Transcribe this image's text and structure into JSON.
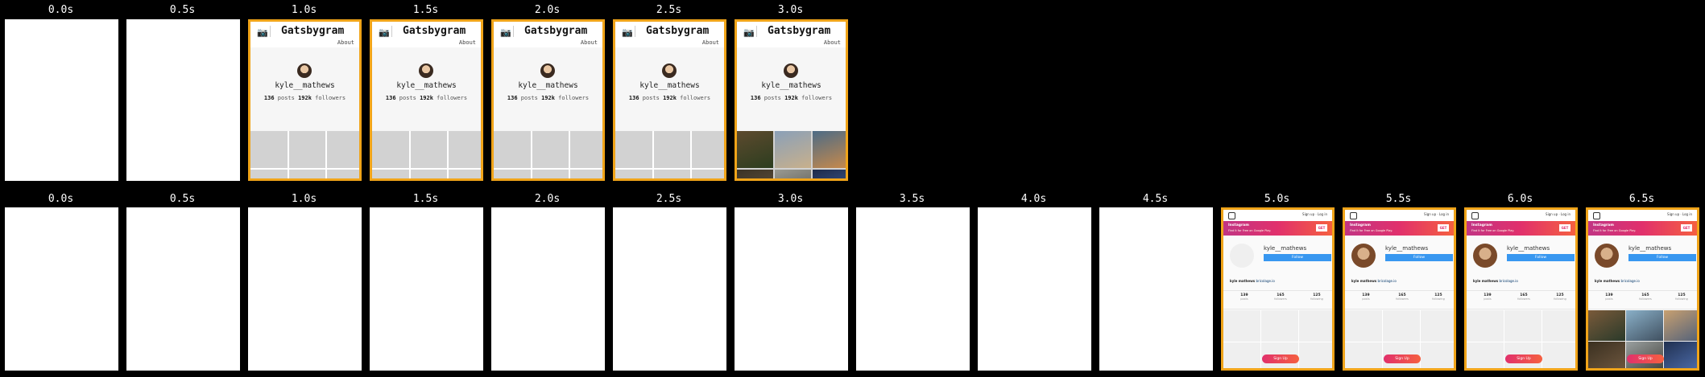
{
  "colors": {
    "highlight": "#f0a419",
    "instagram_blue": "#3897f0"
  },
  "row1": [
    {
      "time": "0.0s",
      "state": "blank"
    },
    {
      "time": "0.5s",
      "state": "blank"
    },
    {
      "time": "1.0s",
      "state": "gatsbygram"
    },
    {
      "time": "1.5s",
      "state": "gatsbygram"
    },
    {
      "time": "2.0s",
      "state": "gatsbygram"
    },
    {
      "time": "2.5s",
      "state": "gatsbygram"
    },
    {
      "time": "3.0s",
      "state": "gatsbygram-images"
    }
  ],
  "row2": [
    {
      "time": "0.0s",
      "state": "blank"
    },
    {
      "time": "0.5s",
      "state": "blank"
    },
    {
      "time": "1.0s",
      "state": "blank"
    },
    {
      "time": "1.5s",
      "state": "blank"
    },
    {
      "time": "2.0s",
      "state": "blank"
    },
    {
      "time": "2.5s",
      "state": "blank"
    },
    {
      "time": "3.0s",
      "state": "blank"
    },
    {
      "time": "3.5s",
      "state": "blank"
    },
    {
      "time": "4.0s",
      "state": "blank"
    },
    {
      "time": "4.5s",
      "state": "blank"
    },
    {
      "time": "5.0s",
      "state": "instagram"
    },
    {
      "time": "5.5s",
      "state": "instagram-avatar"
    },
    {
      "time": "6.0s",
      "state": "instagram-avatar"
    },
    {
      "time": "6.5s",
      "state": "instagram-images"
    }
  ],
  "gatsbygram": {
    "camera_icon": "camera-icon",
    "title": "Gatsbygram",
    "about": "About",
    "username": "kyle__mathews",
    "posts_count": "136",
    "posts_label": "posts",
    "followers_count": "192k",
    "followers_label": "followers"
  },
  "instagram": {
    "top_links": "Sign up · Log in",
    "banner_title": "Instagram",
    "banner_subtitle": "Find It for Free on Google Play.",
    "get_label": "GET",
    "username": "kyle__mathews",
    "follow_label": "Follow",
    "bio_name": "kyle mathews",
    "bio_link": "bricolage.io",
    "stats": [
      {
        "value": "139",
        "label": "posts"
      },
      {
        "value": "165",
        "label": "followers"
      },
      {
        "value": "125",
        "label": "following"
      }
    ],
    "signup_label": "Sign Up"
  }
}
